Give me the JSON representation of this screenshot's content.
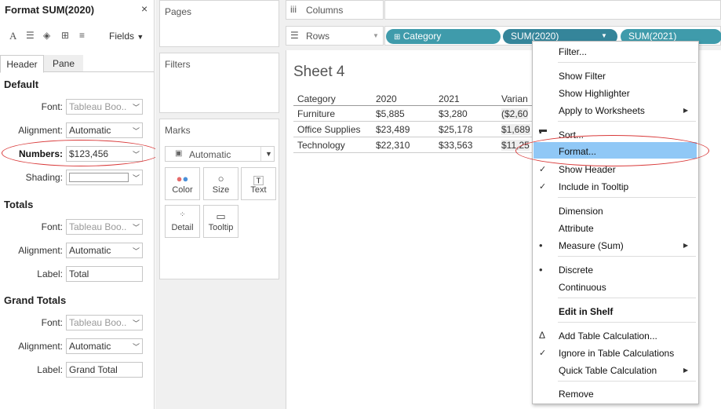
{
  "format_pane": {
    "title": "Format SUM(2020)",
    "close": "×",
    "fields_label": "Fields",
    "tabs": [
      "Header",
      "Pane"
    ],
    "default": {
      "heading": "Default",
      "font_label": "Font:",
      "font_value": "Tableau Boo..",
      "alignment_label": "Alignment:",
      "alignment_value": "Automatic",
      "numbers_label": "Numbers:",
      "numbers_value": "$123,456",
      "shading_label": "Shading:"
    },
    "totals": {
      "heading": "Totals",
      "font_label": "Font:",
      "font_value": "Tableau Boo..",
      "alignment_label": "Alignment:",
      "alignment_value": "Automatic",
      "label_label": "Label:",
      "label_value": "Total"
    },
    "grand_totals": {
      "heading": "Grand Totals",
      "font_label": "Font:",
      "font_value": "Tableau Boo..",
      "alignment_label": "Alignment:",
      "alignment_value": "Automatic",
      "label_label": "Label:",
      "label_value": "Grand Total"
    }
  },
  "cards": {
    "pages": "Pages",
    "filters": "Filters",
    "marks": "Marks",
    "mark_type": "Automatic",
    "mark_buttons": [
      "Color",
      "Size",
      "Text",
      "Detail",
      "Tooltip"
    ]
  },
  "shelves": {
    "columns_label": "Columns",
    "rows_label": "Rows",
    "pills": [
      "Category",
      "SUM(2020)",
      "SUM(2021)"
    ]
  },
  "sheet": {
    "title": "Sheet 4",
    "columns": [
      "Category",
      "2020",
      "2021",
      "Varian"
    ],
    "rows": [
      [
        "Furniture",
        "$5,885",
        "$3,280",
        "($2,60"
      ],
      [
        "Office Supplies",
        "$23,489",
        "$25,178",
        "$1,689"
      ],
      [
        "Technology",
        "$22,310",
        "$33,563",
        "$11,25"
      ]
    ]
  },
  "context_menu": {
    "items": [
      {
        "label": "Filter...",
        "mark": ""
      },
      {
        "label": "Show Filter",
        "mark": ""
      },
      {
        "label": "Show Highlighter",
        "mark": ""
      },
      {
        "label": "Apply to Worksheets",
        "mark": "",
        "submenu": true
      },
      {
        "label": "Sort...",
        "mark": "sort-icon"
      },
      {
        "label": "Format...",
        "mark": "",
        "highlighted": true
      },
      {
        "label": "Show Header",
        "mark": "✓"
      },
      {
        "label": "Include in Tooltip",
        "mark": "✓"
      },
      {
        "label": "Dimension",
        "mark": ""
      },
      {
        "label": "Attribute",
        "mark": ""
      },
      {
        "label": "Measure (Sum)",
        "mark": "•",
        "submenu": true
      },
      {
        "label": "Discrete",
        "mark": "•"
      },
      {
        "label": "Continuous",
        "mark": ""
      },
      {
        "label": "Edit in Shelf",
        "mark": "",
        "bold": true
      },
      {
        "label": "Add Table Calculation...",
        "mark": "Δ"
      },
      {
        "label": "Ignore in Table Calculations",
        "mark": "✓"
      },
      {
        "label": "Quick Table Calculation",
        "mark": "",
        "submenu": true
      },
      {
        "label": "Remove",
        "mark": ""
      }
    ]
  },
  "colors": {
    "pill": "#3f9bab",
    "menu_highlight": "#90c8f6",
    "annotation": "#d93a3a"
  }
}
